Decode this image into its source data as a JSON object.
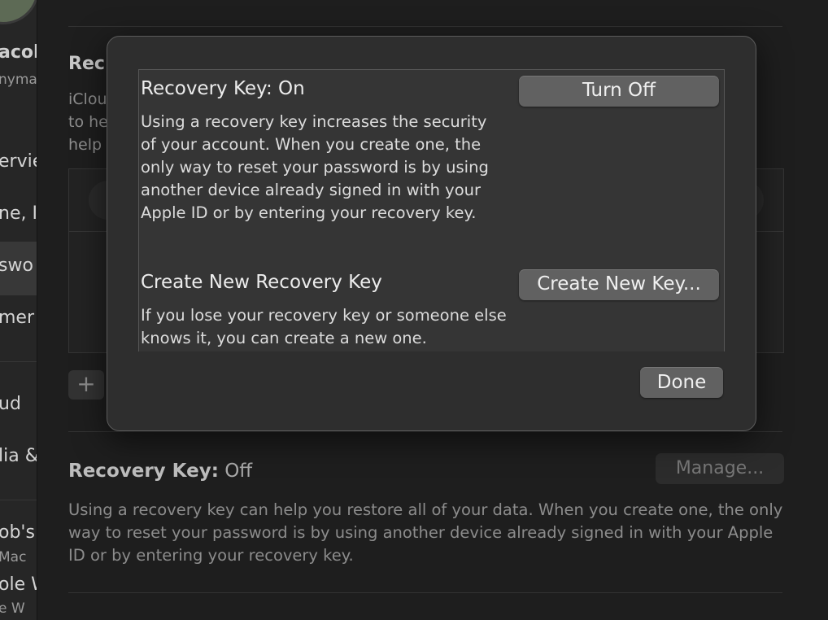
{
  "sidebar": {
    "user_name": "acob",
    "user_email": "nyma",
    "items": [
      "ervie",
      "ne, I",
      "swo",
      "mer",
      "ud",
      "lia &"
    ],
    "device_name": "ob's",
    "device_type": "Mac",
    "watch_name": "ole W",
    "watch_type": "e W"
  },
  "background": {
    "section_heading": "Rec",
    "section_desc": [
      "iClou",
      "to he",
      "help"
    ],
    "add_button": "+",
    "recovery_key_label": "Recovery Key:",
    "recovery_key_status": "Off",
    "manage_button": "Manage...",
    "recovery_key_desc": "Using a recovery key can help you restore all of your data. When you create one, the only way to reset your password is by using another device already signed in with your Apple ID or by entering your recovery key."
  },
  "dialog": {
    "recovery_key_title": "Recovery Key: On",
    "turn_off_button": "Turn Off",
    "recovery_key_desc": "Using a recovery key increases the security of your account. When you create one, the only way to reset your password is by using another device already signed in with your Apple ID or by entering your recovery key.",
    "create_title": "Create New Recovery Key",
    "create_button": "Create New Key...",
    "create_desc": "If you lose your recovery key or someone else knows it, you can create a new one.",
    "done_button": "Done"
  }
}
